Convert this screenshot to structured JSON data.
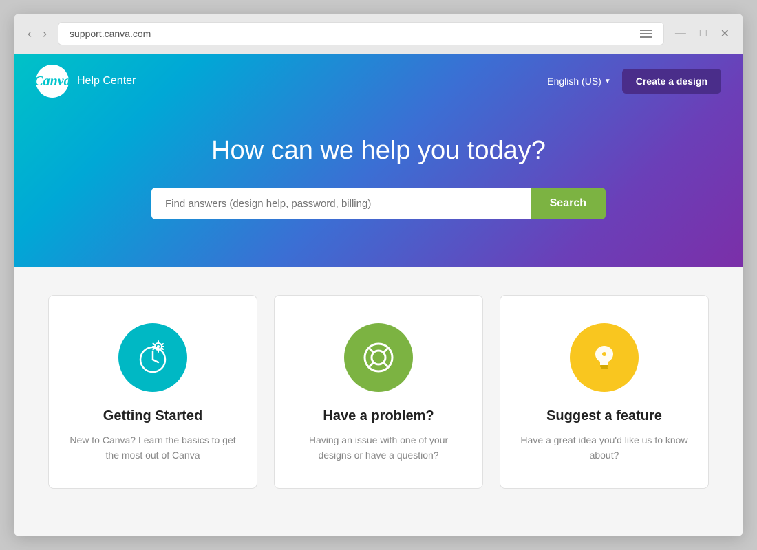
{
  "browser": {
    "url": "support.canva.com",
    "back_btn": "‹",
    "forward_btn": "›",
    "minimize_btn": "—",
    "maximize_btn": "□",
    "close_btn": "✕"
  },
  "header": {
    "logo_text": "Canva",
    "help_center_label": "Help Center",
    "language": "English (US)",
    "create_btn": "Create a design"
  },
  "hero": {
    "title": "How can we help you today?",
    "search_placeholder": "Find answers (design help, password, billing)",
    "search_btn": "Search"
  },
  "cards": [
    {
      "id": "getting-started",
      "title": "Getting Started",
      "description": "New to Canva? Learn the basics to get the most out of Canva",
      "icon_color": "teal"
    },
    {
      "id": "have-a-problem",
      "title": "Have a problem?",
      "description": "Having an issue with one of your designs or have a question?",
      "icon_color": "green"
    },
    {
      "id": "suggest-feature",
      "title": "Suggest a feature",
      "description": "Have a great idea you'd like us to know about?",
      "icon_color": "yellow"
    }
  ]
}
